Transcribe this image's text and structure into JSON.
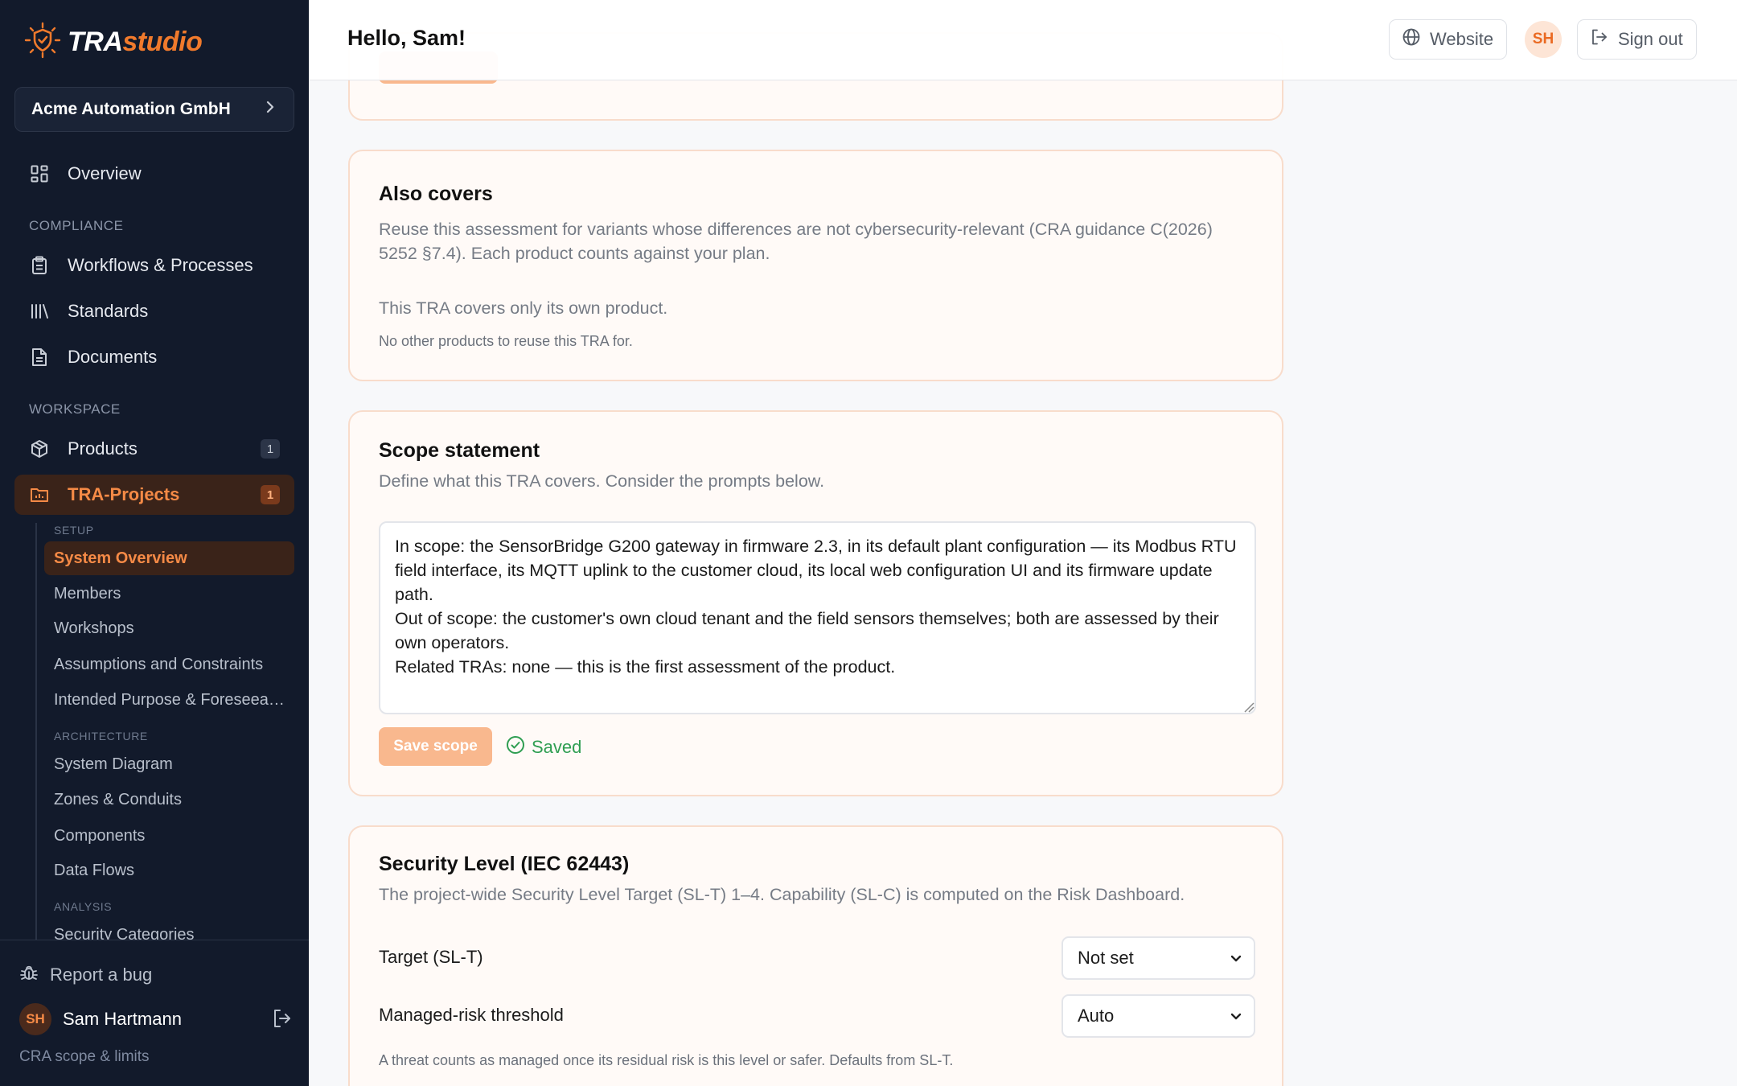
{
  "brand": {
    "name_part1": "TRA",
    "name_part2": "studio"
  },
  "org": {
    "name": "Acme Automation GmbH"
  },
  "nav": {
    "overview": "Overview",
    "section_compliance": "COMPLIANCE",
    "workflows": "Workflows & Processes",
    "standards": "Standards",
    "documents": "Documents",
    "section_workspace": "WORKSPACE",
    "products": "Products",
    "products_count": "1",
    "tra_projects": "TRA-Projects",
    "tra_projects_count": "1"
  },
  "subnav": {
    "setup_label": "SETUP",
    "system_overview": "System Overview",
    "members": "Members",
    "workshops": "Workshops",
    "assumptions": "Assumptions and Constraints",
    "intended_purpose": "Intended Purpose & Foreseeable Use",
    "architecture_label": "ARCHITECTURE",
    "system_diagram": "System Diagram",
    "zones": "Zones & Conduits",
    "components": "Components",
    "data_flows": "Data Flows",
    "analysis_label": "ANALYSIS",
    "security_categories": "Security Categories"
  },
  "footer": {
    "report_bug": "Report a bug",
    "user_initials": "SH",
    "user_name": "Sam Hartmann",
    "cra_link": "CRA scope & limits"
  },
  "header": {
    "greeting": "Hello, Sam!",
    "website": "Website",
    "avatar_initials": "SH",
    "sign_out": "Sign out"
  },
  "also_covers": {
    "title": "Also covers",
    "description": "Reuse this assessment for variants whose differences are not cybersecurity-relevant (CRA guidance C(2026) 5252 §7.4). Each product counts against your plan.",
    "status": "This TRA covers only its own product.",
    "note": "No other products to reuse this TRA for."
  },
  "scope": {
    "title": "Scope statement",
    "description": "Define what this TRA covers. Consider the prompts below.",
    "text": "In scope: the SensorBridge G200 gateway in firmware 2.3, in its default plant configuration — its Modbus RTU field interface, its MQTT uplink to the customer cloud, its local web configuration UI and its firmware update path.\nOut of scope: the customer's own cloud tenant and the field sensors themselves; both are assessed by their own operators.\nRelated TRAs: none — this is the first assessment of the product.",
    "save_label": "Save scope",
    "saved_label": "Saved"
  },
  "security_level": {
    "title": "Security Level (IEC 62443)",
    "description": "The project-wide Security Level Target (SL-T) 1–4. Capability (SL-C) is computed on the Risk Dashboard.",
    "target_label": "Target (SL-T)",
    "target_value": "Not set",
    "threshold_label": "Managed-risk threshold",
    "threshold_value": "Auto",
    "hint": "A threat counts as managed once its residual risk is this level or safer. Defaults from SL-T."
  },
  "colors": {
    "accent": "#f07a2c",
    "sidebar_bg": "#121a2b",
    "card_border": "#f8dccb",
    "saved_green": "#2f9e52"
  }
}
